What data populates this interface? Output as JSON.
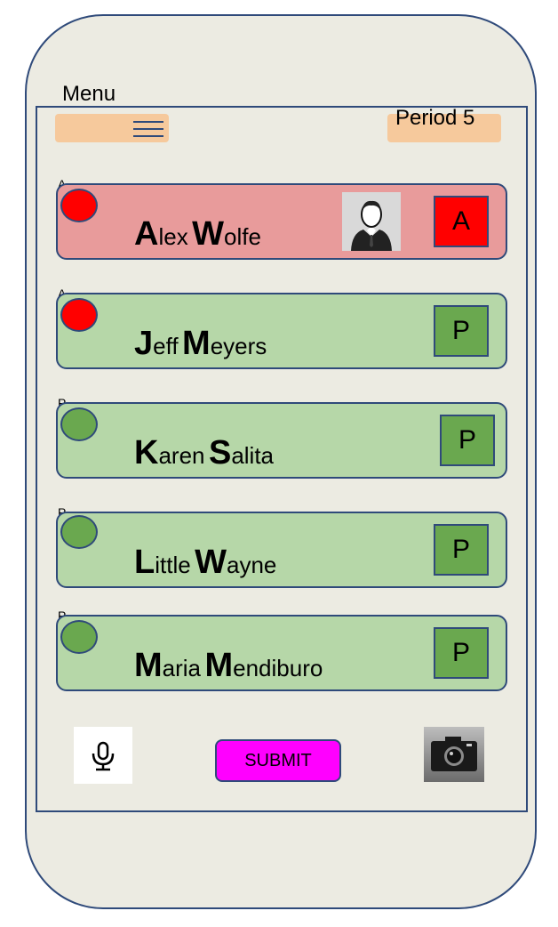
{
  "header": {
    "menu_label": "Menu",
    "period": "Period 5"
  },
  "students": [
    {
      "tag": "A",
      "first_initial": "A",
      "first_rest": "lex",
      "last_initial": "W",
      "last_rest": "olfe",
      "status": "A",
      "state": "absent"
    },
    {
      "tag": "A",
      "first_initial": "J",
      "first_rest": "eff",
      "last_initial": "M",
      "last_rest": "eyers",
      "status": "P",
      "state": "present"
    },
    {
      "tag": "P",
      "first_initial": "K",
      "first_rest": "aren",
      "last_initial": "S",
      "last_rest": "alita",
      "status": "P",
      "state": "present"
    },
    {
      "tag": "P",
      "first_initial": "L",
      "first_rest": "ittle",
      "last_initial": "W",
      "last_rest": "ayne",
      "status": "P",
      "state": "present"
    },
    {
      "tag": "P",
      "first_initial": "M",
      "first_rest": "aria",
      "last_initial": "M",
      "last_rest": "endiburo",
      "status": "P",
      "state": "present"
    }
  ],
  "footer": {
    "submit_label": "SUBMIT",
    "mic_icon": "microphone-icon",
    "camera_icon": "camera-icon"
  },
  "colors": {
    "absent_row": "#e89b9b",
    "present_row": "#b6d7a8",
    "absent_marker": "#ff0000",
    "present_marker": "#6aa84f",
    "submit": "#ff00ff",
    "menu_bg": "#f6c99c",
    "border": "#2f4a7a"
  }
}
